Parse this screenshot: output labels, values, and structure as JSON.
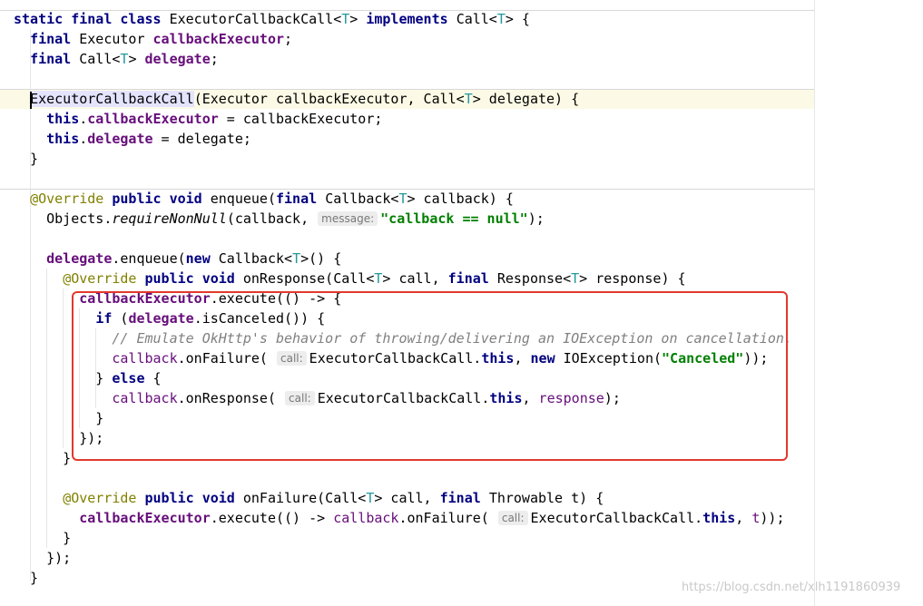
{
  "editor": {
    "language": "java",
    "lines": [
      [
        [
          "kw",
          "static final class "
        ],
        [
          "p",
          "ExecutorCallbackCall<"
        ],
        [
          "tp",
          "T"
        ],
        [
          "p",
          "> "
        ],
        [
          "kw",
          "implements "
        ],
        [
          "p",
          "Call<"
        ],
        [
          "tp",
          "T"
        ],
        [
          "p",
          "> {"
        ]
      ],
      [
        [
          "p",
          "  "
        ],
        [
          "kw",
          "final "
        ],
        [
          "p",
          "Executor "
        ],
        [
          "fld",
          "callbackExecutor"
        ],
        [
          "p",
          ";"
        ]
      ],
      [
        [
          "p",
          "  "
        ],
        [
          "kw",
          "final "
        ],
        [
          "p",
          "Call<"
        ],
        [
          "tp",
          "T"
        ],
        [
          "p",
          "> "
        ],
        [
          "fld",
          "delegate"
        ],
        [
          "p",
          ";"
        ]
      ],
      [],
      [
        [
          "p",
          "  "
        ],
        [
          "cw",
          "ExecutorCallbackCall"
        ],
        [
          "p",
          "(Executor callbackExecutor, Call<"
        ],
        [
          "tp",
          "T"
        ],
        [
          "p",
          "> delegate) {"
        ]
      ],
      [
        [
          "p",
          "    "
        ],
        [
          "kw",
          "this"
        ],
        [
          "p",
          "."
        ],
        [
          "fld",
          "callbackExecutor"
        ],
        [
          "p",
          " = callbackExecutor;"
        ]
      ],
      [
        [
          "p",
          "    "
        ],
        [
          "kw",
          "this"
        ],
        [
          "p",
          "."
        ],
        [
          "fld",
          "delegate"
        ],
        [
          "p",
          " = delegate;"
        ]
      ],
      [
        [
          "p",
          "  }"
        ]
      ],
      [],
      [
        [
          "p",
          "  "
        ],
        [
          "ann",
          "@Override "
        ],
        [
          "kw",
          "public void "
        ],
        [
          "p",
          "enqueue("
        ],
        [
          "kw",
          "final "
        ],
        [
          "p",
          "Callback<"
        ],
        [
          "tp",
          "T"
        ],
        [
          "p",
          "> callback) {"
        ]
      ],
      [
        [
          "p",
          "    Objects."
        ],
        [
          "it",
          "requireNonNull"
        ],
        [
          "p",
          "(callback, "
        ],
        [
          "hint",
          "message:"
        ],
        [
          "str",
          "\"callback == null\""
        ],
        [
          "p",
          ");"
        ]
      ],
      [],
      [
        [
          "p",
          "    "
        ],
        [
          "fld",
          "delegate"
        ],
        [
          "p",
          ".enqueue("
        ],
        [
          "kw",
          "new "
        ],
        [
          "p",
          "Callback<"
        ],
        [
          "tp",
          "T"
        ],
        [
          "p",
          ">() {"
        ]
      ],
      [
        [
          "p",
          "      "
        ],
        [
          "ann",
          "@Override "
        ],
        [
          "kw",
          "public void "
        ],
        [
          "p",
          "onResponse(Call<"
        ],
        [
          "tp",
          "T"
        ],
        [
          "p",
          "> call, "
        ],
        [
          "kw",
          "final "
        ],
        [
          "p",
          "Response<"
        ],
        [
          "tp",
          "T"
        ],
        [
          "p",
          "> response) {"
        ]
      ],
      [
        [
          "p",
          "        "
        ],
        [
          "fld",
          "callbackExecutor"
        ],
        [
          "p",
          ".execute(() -> {"
        ]
      ],
      [
        [
          "p",
          "          "
        ],
        [
          "kw",
          "if "
        ],
        [
          "p",
          "("
        ],
        [
          "fld",
          "delegate"
        ],
        [
          "p",
          ".isCanceled()) {"
        ]
      ],
      [
        [
          "p",
          "            "
        ],
        [
          "cmt",
          "// Emulate OkHttp's behavior of throwing/delivering an IOException on cancellation."
        ]
      ],
      [
        [
          "p",
          "            "
        ],
        [
          "pv",
          "callback"
        ],
        [
          "p",
          ".onFailure( "
        ],
        [
          "hint",
          "call:"
        ],
        [
          "p",
          "ExecutorCallbackCall."
        ],
        [
          "kw",
          "this"
        ],
        [
          "p",
          ", "
        ],
        [
          "kw",
          "new "
        ],
        [
          "p",
          "IOException("
        ],
        [
          "str",
          "\"Canceled\""
        ],
        [
          "p",
          "));"
        ]
      ],
      [
        [
          "p",
          "          } "
        ],
        [
          "kw",
          "else "
        ],
        [
          "p",
          "{"
        ]
      ],
      [
        [
          "p",
          "            "
        ],
        [
          "pv",
          "callback"
        ],
        [
          "p",
          ".onResponse( "
        ],
        [
          "hint",
          "call:"
        ],
        [
          "p",
          "ExecutorCallbackCall."
        ],
        [
          "kw",
          "this"
        ],
        [
          "p",
          ", "
        ],
        [
          "pv",
          "response"
        ],
        [
          "p",
          ");"
        ]
      ],
      [
        [
          "p",
          "          }"
        ]
      ],
      [
        [
          "p",
          "        });"
        ]
      ],
      [
        [
          "p",
          "      }"
        ]
      ],
      [],
      [
        [
          "p",
          "      "
        ],
        [
          "ann",
          "@Override "
        ],
        [
          "kw",
          "public void "
        ],
        [
          "p",
          "onFailure(Call<"
        ],
        [
          "tp",
          "T"
        ],
        [
          "p",
          "> call, "
        ],
        [
          "kw",
          "final "
        ],
        [
          "p",
          "Throwable t) {"
        ]
      ],
      [
        [
          "p",
          "        "
        ],
        [
          "fld",
          "callbackExecutor"
        ],
        [
          "p",
          ".execute(() -> "
        ],
        [
          "pv",
          "callback"
        ],
        [
          "p",
          ".onFailure( "
        ],
        [
          "hint",
          "call:"
        ],
        [
          "p",
          "ExecutorCallbackCall."
        ],
        [
          "kw",
          "this"
        ],
        [
          "p",
          ", "
        ],
        [
          "pv",
          "t"
        ],
        [
          "p",
          "));"
        ]
      ],
      [
        [
          "p",
          "      }"
        ]
      ],
      [
        [
          "p",
          "    });"
        ]
      ],
      [
        [
          "p",
          "  }"
        ]
      ]
    ]
  },
  "watermark": "https://blog.csdn.net/xlh1191860939"
}
